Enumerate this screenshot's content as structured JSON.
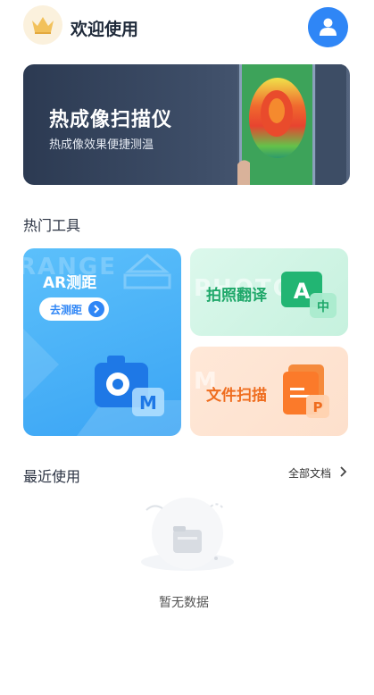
{
  "header": {
    "welcome": "欢迎使用",
    "crown_icon": "crown-icon",
    "avatar_icon": "user-icon"
  },
  "banner": {
    "title": "热成像扫描仪",
    "subtitle": "热成像效果便捷测温"
  },
  "hot_tools": {
    "title": "热门工具",
    "ar": {
      "title": "AR测距",
      "button": "去测距",
      "ghost": "RANGE"
    },
    "translate": {
      "title": "拍照翻译",
      "ghost": "PHOTO",
      "badge": "A",
      "badge_sub": "中"
    },
    "doc_scan": {
      "title": "文件扫描",
      "ghost": "M",
      "badge": "P"
    }
  },
  "recent": {
    "title": "最近使用",
    "all_docs": "全部文档",
    "empty_text": "暂无数据"
  },
  "colors": {
    "accent": "#2f86f6",
    "green": "#1fa86a",
    "orange": "#ef6d1f"
  }
}
